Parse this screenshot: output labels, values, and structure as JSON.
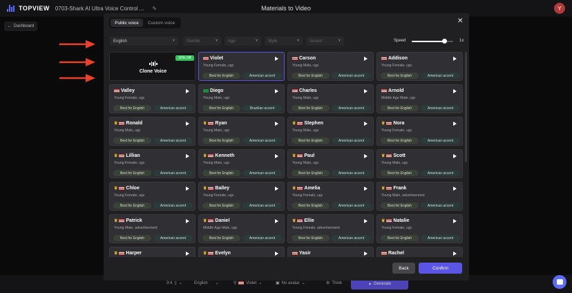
{
  "app": {
    "logo": "TOPVIEW",
    "project": "0703-Shark AI Ultra Voice Control ...",
    "title": "Materials to Video",
    "avatar": "Y",
    "back_link": "Dashboard"
  },
  "bottom": {
    "ratio": "3:4",
    "language": "English",
    "voice": "Violet",
    "avatar": "No avatar",
    "think": "Think",
    "generate": "Generate"
  },
  "modal": {
    "tabs": [
      "Public voice",
      "Custom voice"
    ],
    "filters": {
      "language": "English",
      "gender": "Gender",
      "age": "Age",
      "style": "Style",
      "accent": "Accent"
    },
    "speed": {
      "label": "Speed",
      "value": "1x",
      "level": 0.78
    },
    "clone": {
      "label": "Clone Voice",
      "badge": "50% Off"
    },
    "voices": [
      {
        "name": "Violet",
        "desc": "Young Female, ugc",
        "tag1": "Best for English",
        "tag2": "American accent",
        "crown": false,
        "flag": "us",
        "selected": true
      },
      {
        "name": "Carson",
        "desc": "Young Male, ugc",
        "tag1": "Best for English",
        "tag2": "American accent",
        "crown": false,
        "flag": "us"
      },
      {
        "name": "Addison",
        "desc": "Young Female, ugc",
        "tag1": "Best for English",
        "tag2": "American accent",
        "crown": false,
        "flag": "us"
      },
      {
        "name": "Valley",
        "desc": "Young Female, ugc",
        "tag1": "Best for English",
        "tag2": "American accent",
        "crown": false,
        "flag": "us"
      },
      {
        "name": "Diego",
        "desc": "Young Male, ugc",
        "tag1": "Best for English",
        "tag2": "Brazilian accent",
        "crown": false,
        "flag": "br"
      },
      {
        "name": "Charles",
        "desc": "Young Male, ugc",
        "tag1": "Best for English",
        "tag2": "American accent",
        "crown": false,
        "flag": "us"
      },
      {
        "name": "Arnold",
        "desc": "Middle Age Male, ugc",
        "tag1": "Best for English",
        "tag2": "American accent",
        "crown": false,
        "flag": "us"
      },
      {
        "name": "Ronald",
        "desc": "Young Male, ugc",
        "tag1": "Best for English",
        "tag2": "American accent",
        "crown": true,
        "flag": "us"
      },
      {
        "name": "Ryan",
        "desc": "Young Male, ugc",
        "tag1": "Best for English",
        "tag2": "American accent",
        "crown": true,
        "flag": "us"
      },
      {
        "name": "Stephen",
        "desc": "Young Male, ugc",
        "tag1": "Best for English",
        "tag2": "American accent",
        "crown": true,
        "flag": "us"
      },
      {
        "name": "Nora",
        "desc": "Young Female, ugc",
        "tag1": "Best for English",
        "tag2": "American accent",
        "crown": true,
        "flag": "us"
      },
      {
        "name": "Lillian",
        "desc": "Young Female, ugc",
        "tag1": "Best for English",
        "tag2": "American accent",
        "crown": true,
        "flag": "us"
      },
      {
        "name": "Kenneth",
        "desc": "Young Male, ugc",
        "tag1": "Best for English",
        "tag2": "American accent",
        "crown": true,
        "flag": "us"
      },
      {
        "name": "Paul",
        "desc": "Young Male, ugc",
        "tag1": "Best for English",
        "tag2": "American accent",
        "crown": true,
        "flag": "us"
      },
      {
        "name": "Scott",
        "desc": "Young Male, ugc",
        "tag1": "Best for English",
        "tag2": "American accent",
        "crown": true,
        "flag": "us"
      },
      {
        "name": "Chloe",
        "desc": "Young Female, ugc",
        "tag1": "Best for English",
        "tag2": "American accent",
        "crown": true,
        "flag": "us"
      },
      {
        "name": "Bailey",
        "desc": "Young Female, ugc",
        "tag1": "Best for English",
        "tag2": "American accent",
        "crown": true,
        "flag": "us"
      },
      {
        "name": "Amelia",
        "desc": "Young Female, ugc",
        "tag1": "Best for English",
        "tag2": "American accent",
        "crown": true,
        "flag": "us"
      },
      {
        "name": "Frank",
        "desc": "Young Male, advertisement",
        "tag1": "Best for English",
        "tag2": "American accent",
        "crown": true,
        "flag": "us"
      },
      {
        "name": "Patrick",
        "desc": "Young Male, advertisement",
        "tag1": "Best for English",
        "tag2": "American accent",
        "crown": true,
        "flag": "us"
      },
      {
        "name": "Daniel",
        "desc": "Middle Age Male, ugc",
        "tag1": "Best for English",
        "tag2": "American accent",
        "crown": true,
        "flag": "us"
      },
      {
        "name": "Ellie",
        "desc": "Young Female, advertisement",
        "tag1": "Best for English",
        "tag2": "American accent",
        "crown": true,
        "flag": "us"
      },
      {
        "name": "Natalie",
        "desc": "Young Female, ugc",
        "tag1": "Best for English",
        "tag2": "American accent",
        "crown": true,
        "flag": "us"
      },
      {
        "name": "Harper",
        "desc": "",
        "tag1": "",
        "tag2": "",
        "crown": true,
        "flag": "us"
      },
      {
        "name": "Evelyn",
        "desc": "",
        "tag1": "",
        "tag2": "",
        "crown": true,
        "flag": "us"
      },
      {
        "name": "Yasir",
        "desc": "",
        "tag1": "",
        "tag2": "",
        "crown": false,
        "flag": "us"
      },
      {
        "name": "Rachel",
        "desc": "",
        "tag1": "",
        "tag2": "",
        "crown": false,
        "flag": "us"
      }
    ],
    "buttons": {
      "back": "Back",
      "confirm": "Confirm"
    }
  },
  "colors": {
    "accent": "#5b55e6",
    "badge": "#35c25a",
    "arrow": "#e8412c"
  }
}
